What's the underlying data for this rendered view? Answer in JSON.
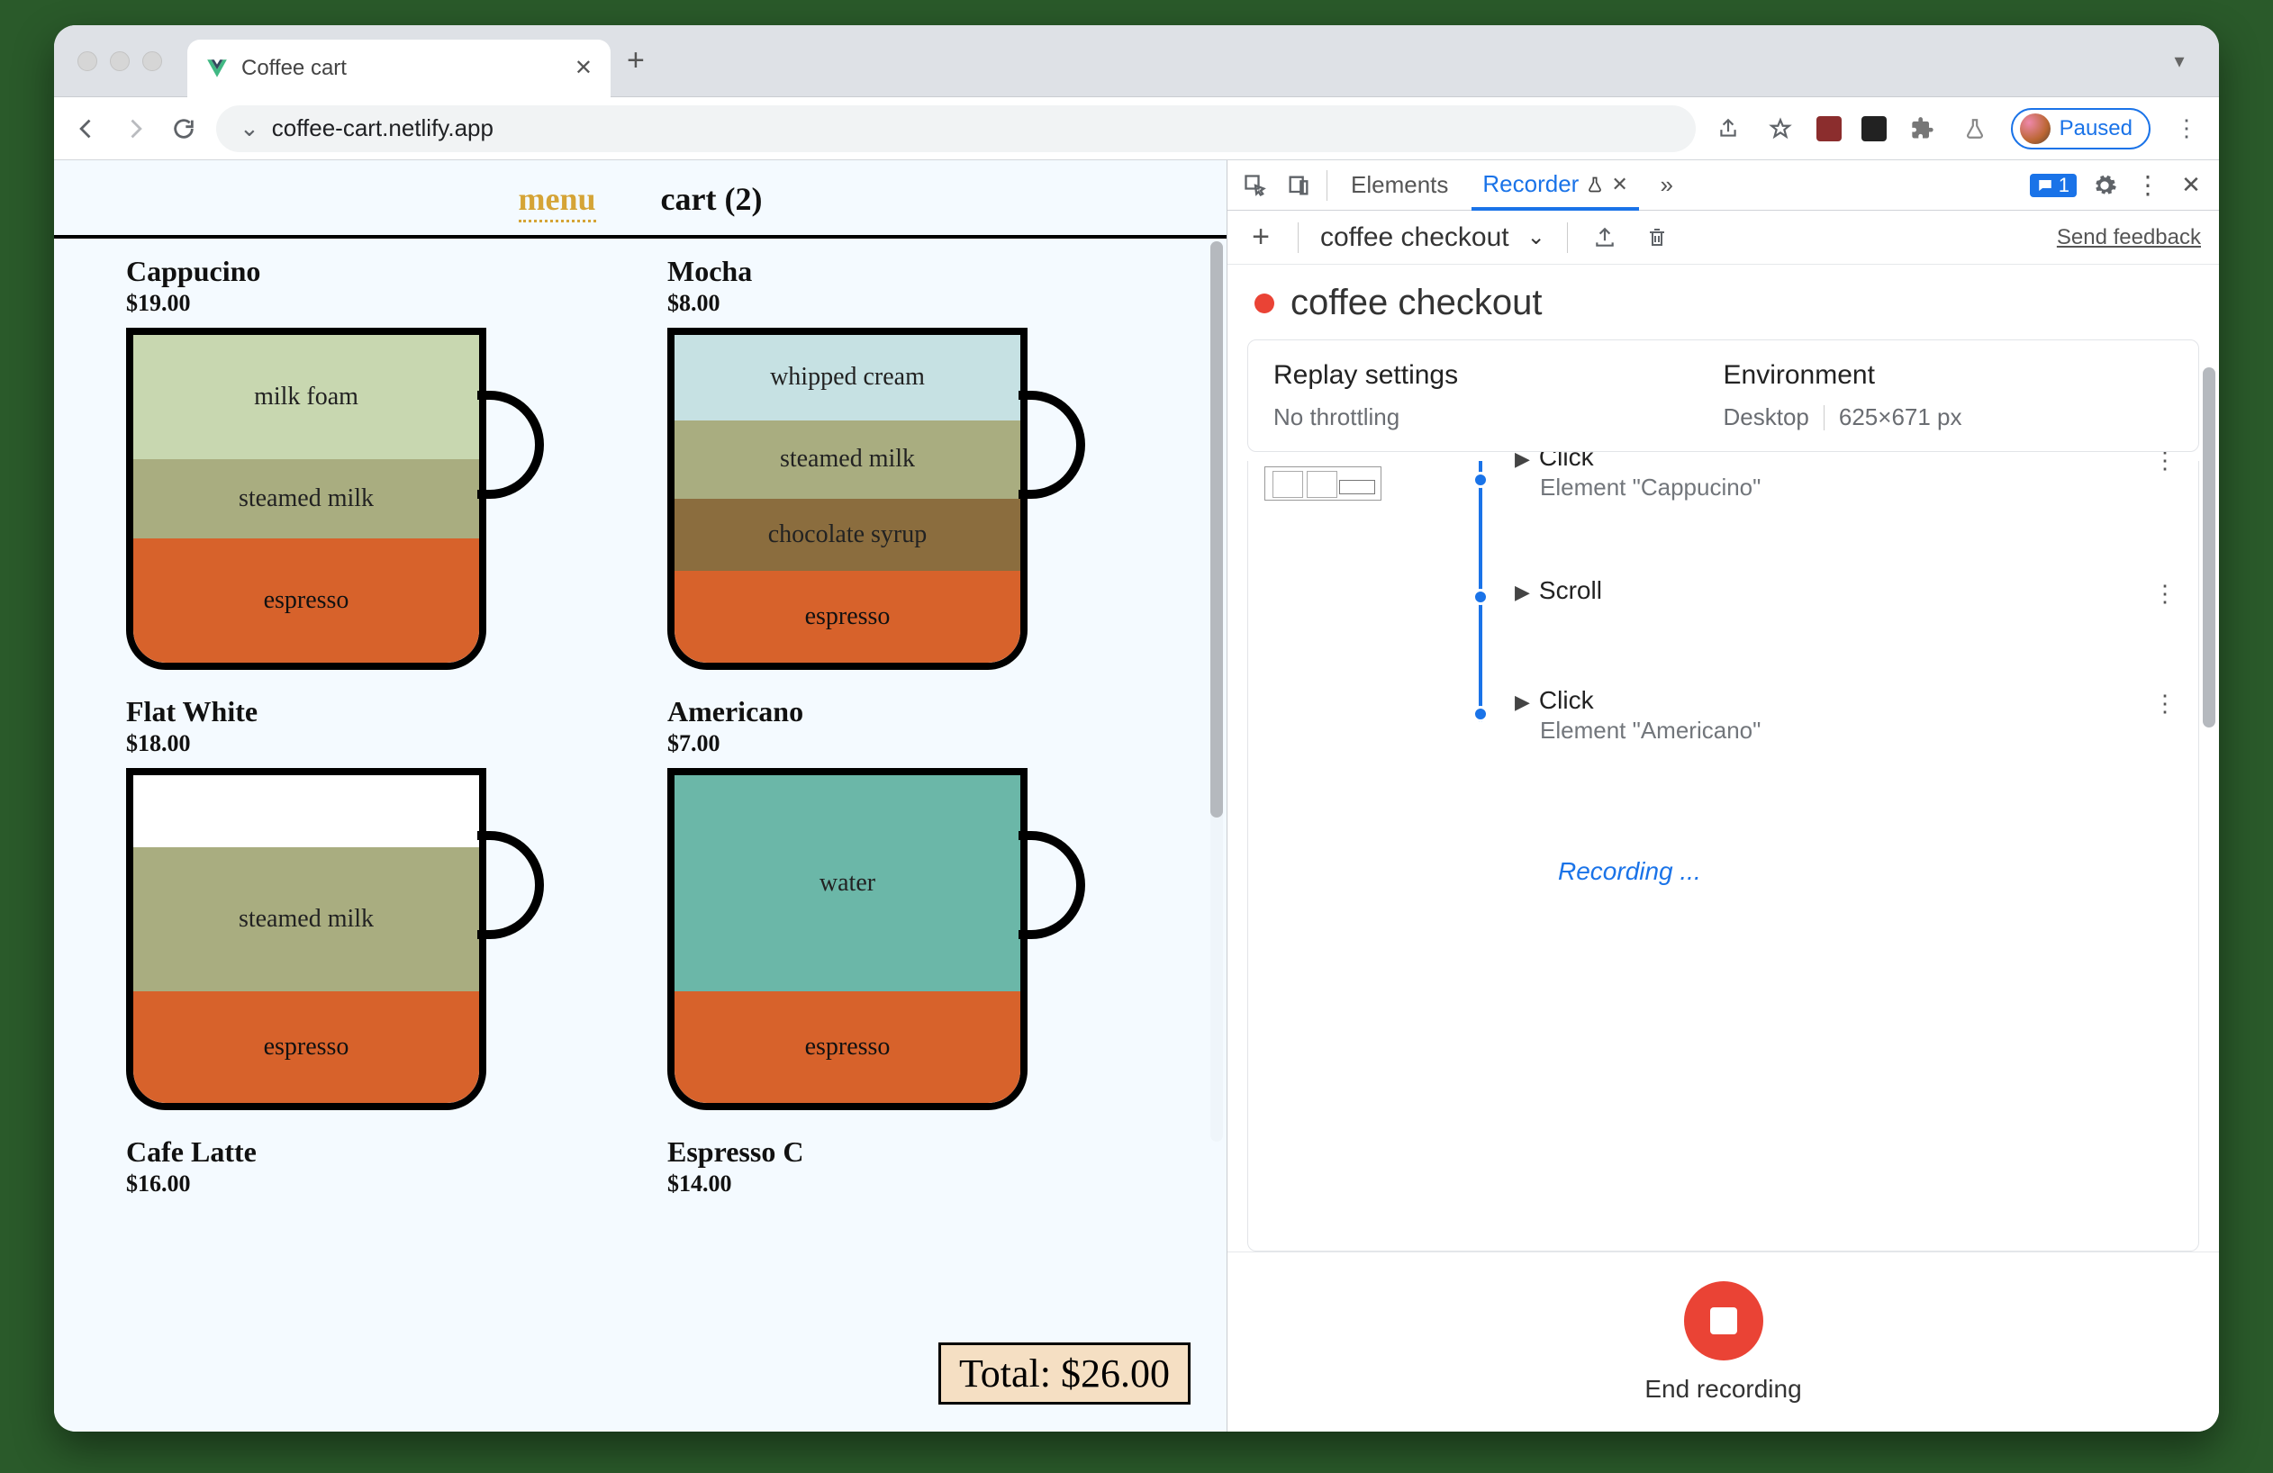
{
  "browser": {
    "tab_title": "Coffee cart",
    "url": "coffee-cart.netlify.app",
    "paused_label": "Paused"
  },
  "page": {
    "nav": {
      "menu": "menu",
      "cart": "cart (2)"
    },
    "coffees": [
      {
        "name": "Cappucino",
        "price": "$19.00",
        "layers": [
          {
            "label": "milk foam",
            "cls": "l-milkfoam",
            "h": 38
          },
          {
            "label": "steamed milk",
            "cls": "l-steamed",
            "h": 24
          },
          {
            "label": "espresso",
            "cls": "l-espresso",
            "h": 38
          }
        ]
      },
      {
        "name": "Mocha",
        "price": "$8.00",
        "layers": [
          {
            "label": "whipped cream",
            "cls": "l-whip",
            "h": 26
          },
          {
            "label": "steamed milk",
            "cls": "l-steamed",
            "h": 24
          },
          {
            "label": "chocolate syrup",
            "cls": "l-choc",
            "h": 22
          },
          {
            "label": "espresso",
            "cls": "l-espresso",
            "h": 28
          }
        ]
      },
      {
        "name": "Flat White",
        "price": "$18.00",
        "layers": [
          {
            "label": "",
            "cls": "l-empty",
            "h": 22
          },
          {
            "label": "steamed milk",
            "cls": "l-steamed",
            "h": 44
          },
          {
            "label": "espresso",
            "cls": "l-espresso",
            "h": 34
          }
        ]
      },
      {
        "name": "Americano",
        "price": "$7.00",
        "layers": [
          {
            "label": "water",
            "cls": "l-water",
            "h": 66
          },
          {
            "label": "espresso",
            "cls": "l-espresso",
            "h": 34
          }
        ]
      },
      {
        "name": "Cafe Latte",
        "price": "$16.00",
        "layers": []
      },
      {
        "name": "Espresso C",
        "price": "$14.00",
        "layers": []
      }
    ],
    "total": "Total: $26.00"
  },
  "devtools": {
    "tabs": {
      "elements": "Elements",
      "recorder": "Recorder"
    },
    "messages_count": "1",
    "recording_name": "coffee checkout",
    "feedback": "Send feedback",
    "title": "coffee checkout",
    "replay": {
      "heading": "Replay settings",
      "value": "No throttling"
    },
    "env": {
      "heading": "Environment",
      "device": "Desktop",
      "size": "625×671 px"
    },
    "steps": [
      {
        "title": "Click",
        "sub": "Element \"Cappucino\""
      },
      {
        "title": "Scroll",
        "sub": ""
      },
      {
        "title": "Click",
        "sub": "Element \"Americano\""
      }
    ],
    "recording_label": "Recording ...",
    "end_label": "End recording"
  }
}
